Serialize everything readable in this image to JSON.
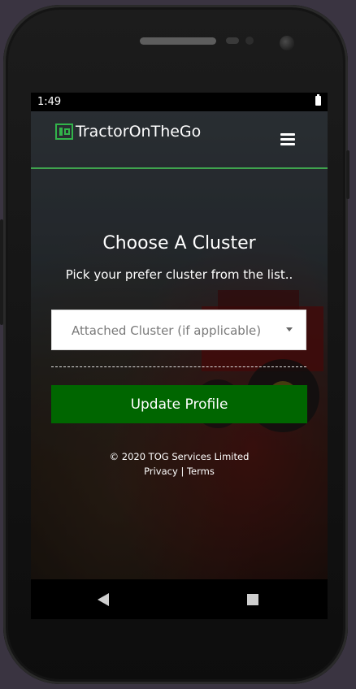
{
  "status_bar": {
    "time": "1:49"
  },
  "header": {
    "brand": "TractorOnTheGo"
  },
  "main": {
    "title": "Choose A Cluster",
    "subtitle": "Pick your prefer cluster from the list..",
    "cluster_select": {
      "selected": "Attached Cluster (if applicable)"
    },
    "update_button": "Update Profile"
  },
  "footer": {
    "copyright": "© 2020 TOG Services Limited",
    "privacy": "Privacy",
    "separator": "|",
    "terms": "Terms"
  },
  "colors": {
    "accent": "#3fa34d",
    "button": "#006600"
  }
}
